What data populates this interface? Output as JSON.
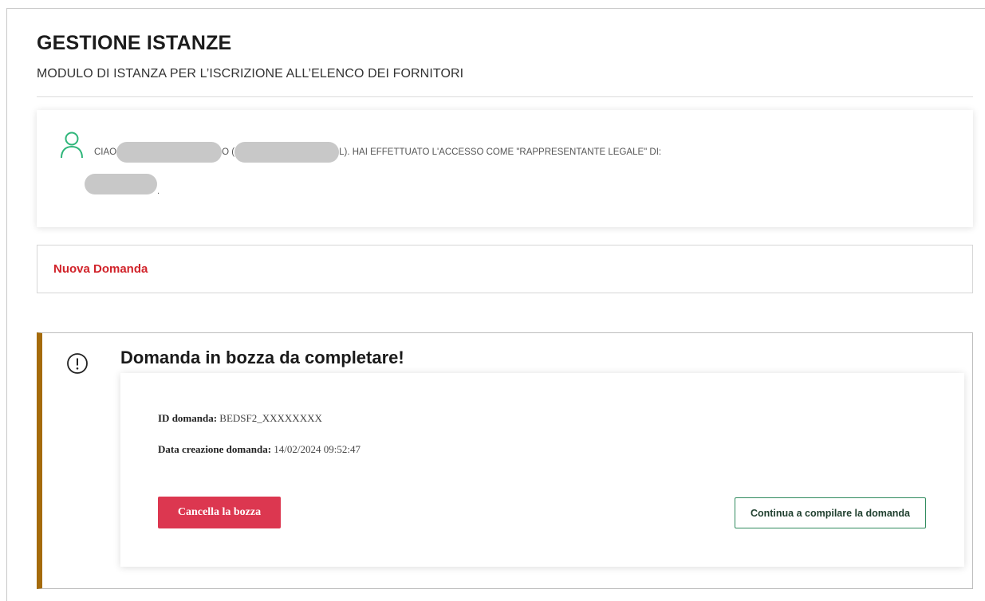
{
  "header": {
    "title": "GESTIONE ISTANZE",
    "subtitle": "MODULO DI ISTANZA PER L’ISCRIZIONE ALL’ELENCO DEI FORNITORI"
  },
  "user_card": {
    "greeting_prefix": "CIAO",
    "greeting_mid": "O (",
    "greeting_suffix": "L). HAI EFFETTUATO L'ACCESSO COME \"RAPPRESENTANTE LEGALE\" DI:",
    "org_suffix": ".",
    "icon": "user-icon",
    "accent_color": "#2fb67a"
  },
  "nuova_domanda": {
    "label": "Nuova Domanda",
    "color": "#d1232a"
  },
  "draft": {
    "title": "Domanda in bozza da completare!",
    "icon": "alert-circle-icon",
    "accent_color": "#a56b0b",
    "id_label": "ID domanda:",
    "id_value": "BEDSF2_XXXXXXXX",
    "date_label": "Data creazione domanda:",
    "date_value": "14/02/2024 09:52:47",
    "cancel_label": "Cancella la bozza",
    "continue_label": "Continua a compilare la domanda",
    "cancel_color": "#dc3750",
    "continue_border_color": "#2f8a5d"
  }
}
